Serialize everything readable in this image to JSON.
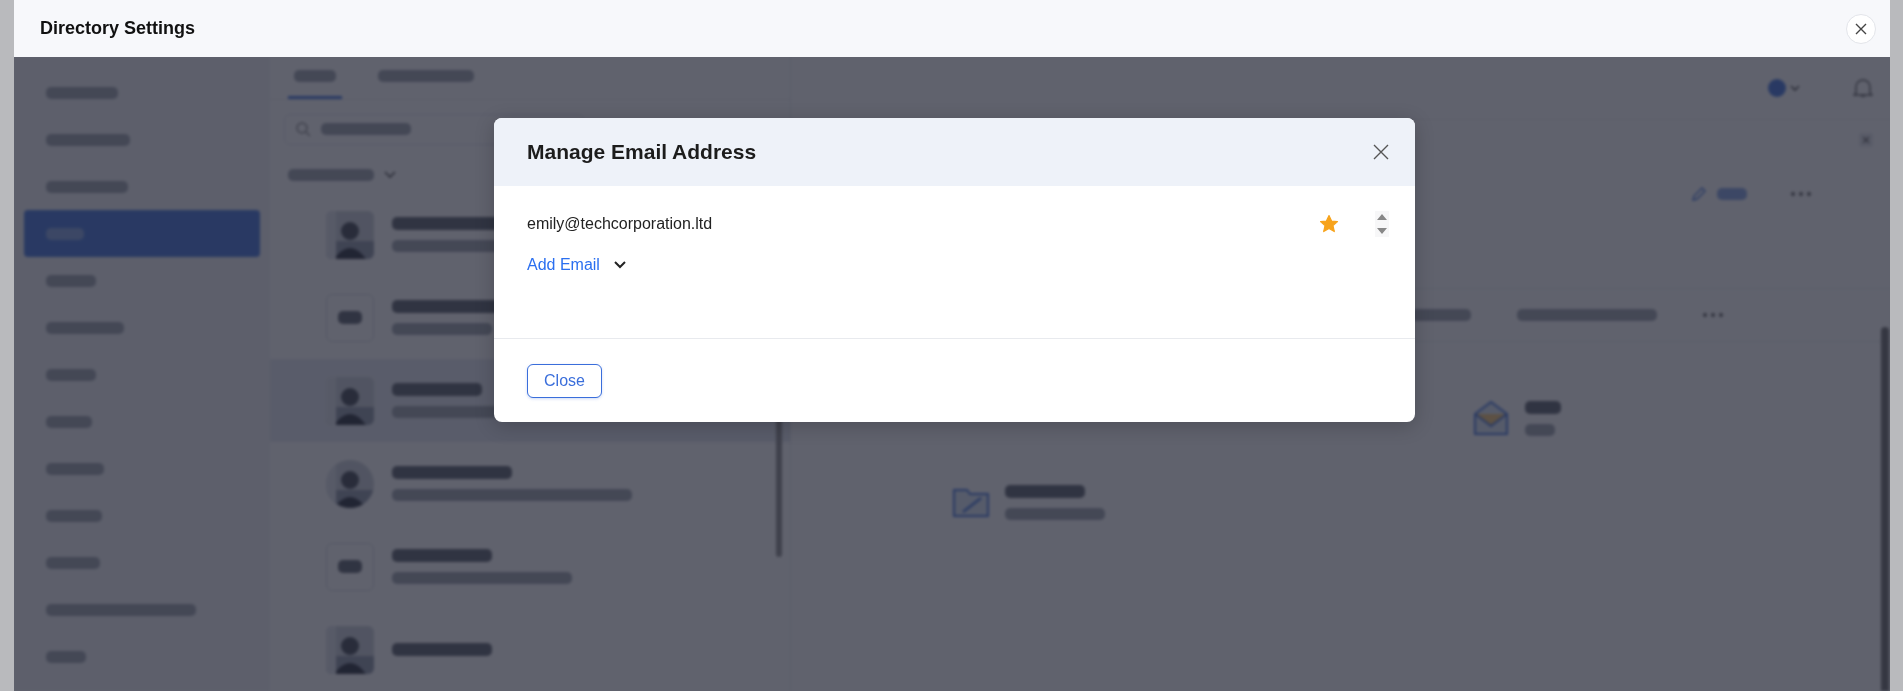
{
  "window": {
    "title": "Directory Settings"
  },
  "modal": {
    "title": "Manage Email Address",
    "emails": [
      {
        "address": "emily@techcorporation.ltd",
        "primary": true
      }
    ],
    "add_email": "Add Email",
    "close": "Close"
  }
}
